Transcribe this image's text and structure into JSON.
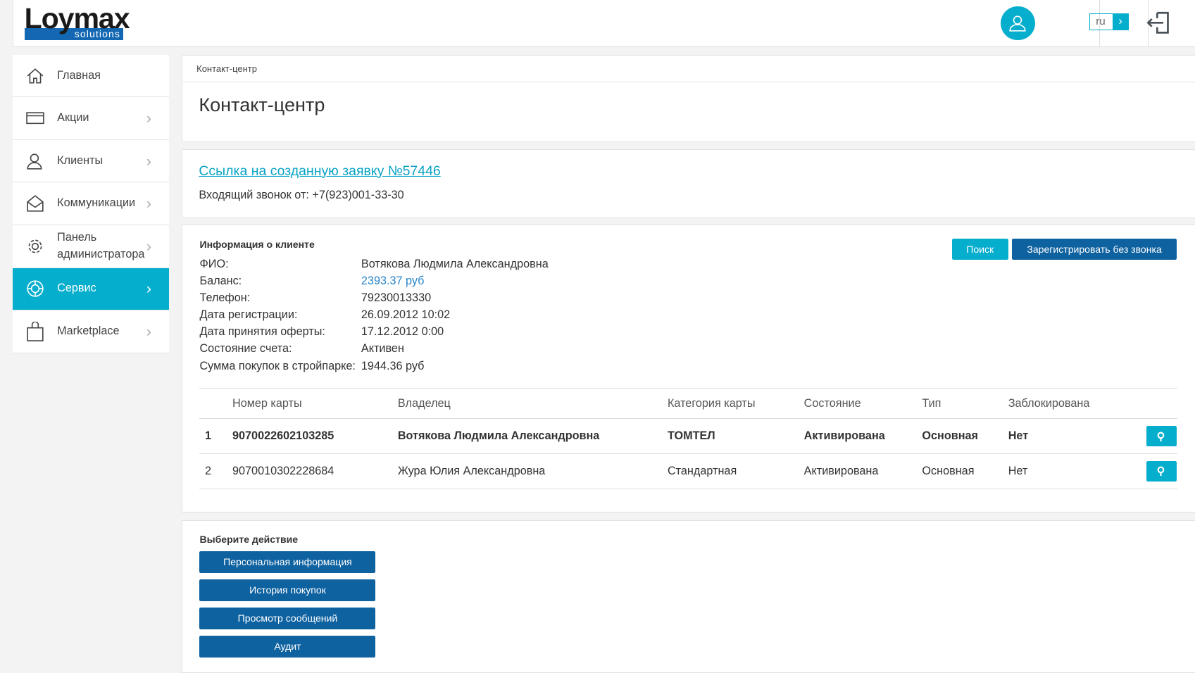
{
  "header": {
    "logo_text": "Loymax",
    "logo_sub": "solutions",
    "lang": "ru"
  },
  "sidebar": {
    "items": [
      {
        "label": "Главная"
      },
      {
        "label": "Акции"
      },
      {
        "label": "Клиенты"
      },
      {
        "label": "Коммуникации"
      },
      {
        "label": "Панель администратора"
      },
      {
        "label": "Сервис"
      },
      {
        "label": "Marketplace"
      }
    ]
  },
  "breadcrumb": "Контакт-центр",
  "page_title": "Контакт-центр",
  "ticket": {
    "link": "Ссылка на созданную заявку №57446",
    "call": "Входящий звонок от: +7(923)001-33-30"
  },
  "client": {
    "heading": "Информация о клиенте",
    "search_label": "Поиск",
    "register_label": "Зарегистрировать без звонка",
    "fields": [
      {
        "k": "ФИО:",
        "v": "Вотякова Людмила Александровна"
      },
      {
        "k": "Баланс:",
        "v": "2393.37 руб"
      },
      {
        "k": "Телефон:",
        "v": "79230013330"
      },
      {
        "k": "Дата регистрации:",
        "v": "26.09.2012 10:02"
      },
      {
        "k": "Дата принятия оферты:",
        "v": "17.12.2012 0:00"
      },
      {
        "k": "Состояние счета:",
        "v": "Активен"
      },
      {
        "k": "Сумма покупок в стройпарке:",
        "v": "1944.36 руб"
      }
    ]
  },
  "cards": {
    "columns": [
      "Номер карты",
      "Владелец",
      "Категория карты",
      "Состояние",
      "Тип",
      "Заблокирована"
    ],
    "rows": [
      [
        "1",
        "9070022602103285",
        "Вотякова Людмила Александровна",
        "ТОМТЕЛ",
        "Активирована",
        "Основная",
        "Нет"
      ],
      [
        "2",
        "9070010302228684",
        "Жура Юлия Александровна",
        "Стандартная",
        "Активирована",
        "Основная",
        "Нет"
      ]
    ]
  },
  "actions": {
    "heading": "Выберите действие",
    "buttons": [
      "Персональная информация",
      "История покупок",
      "Просмотр сообщений",
      "Аудит"
    ]
  },
  "colors": {
    "accent": "#06aecd",
    "primary": "#0f62a0"
  }
}
